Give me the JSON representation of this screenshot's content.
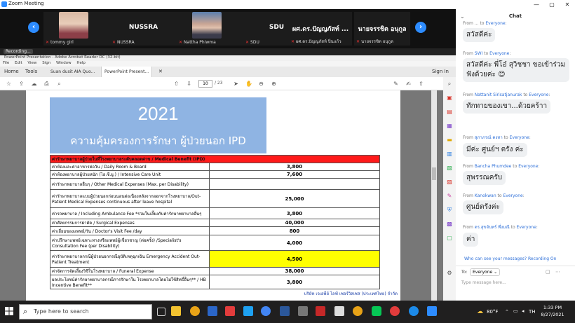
{
  "window": {
    "title": "Zoom Meeting",
    "min": "—",
    "max": "▢",
    "close": "✕"
  },
  "participants": [
    {
      "name": "",
      "label": "tommy girl",
      "photo": true
    },
    {
      "name": "NUSSRA",
      "label": "NUSSRA",
      "photo": false
    },
    {
      "name": "",
      "label": "Nattha Phiwma",
      "photo": true
    },
    {
      "name": "SDU",
      "label": "SDU",
      "photo": false
    },
    {
      "name": "ผศ.ดร.ปัญญภัสท์ ...",
      "label": "ผศ.ดร.ปัญญภัสท์ ปิ่นแก้ว",
      "photo": false
    },
    {
      "name": "นายจรรชิต อนุกูล",
      "label": "นายจรรชิต อนุกูล",
      "photo": false
    }
  ],
  "recording": "Recording...",
  "acrobat": {
    "title": "PowerPoint Presentation - Adobe Acrobat Reader DC (32-bit)",
    "menu": [
      "File",
      "Edit",
      "View",
      "Sign",
      "Window",
      "Help"
    ],
    "tabs": [
      "Home",
      "Tools",
      "Suan dusit AIA Quo...",
      "PowerPoint Present..."
    ],
    "sign_in": "Sign In",
    "page_current": "10",
    "page_total": "/ 23"
  },
  "slide": {
    "year": "2021",
    "subtitle": "ความคุ้มครองการรักษา ผู้ป่วยนอก IPD",
    "header": "ค่ารักษาพยาบาลผู้ป่วยในที่โรงพยาบาลระดับคลอดค่าข / Medical Benefit (IPD)",
    "rows": [
      {
        "label": "ค่าห้องและค่าอาหารต่อวัน  /  Daily Room & Board",
        "value": "3,800",
        "highlight": false
      },
      {
        "label": "ค่าห้องพยาบาลผู้ป่วยหนัก (ไอ.ซี.ยู.)  /  Intensive Care Unit",
        "value": "7,600",
        "highlight": false
      },
      {
        "label": "ค่ารักษาพยาบาลอื่นๆ / Other Medical Expenses (Max. per Disability)",
        "value": "",
        "highlight": false
      },
      {
        "label": "ค่ารักษาพยาบาลแบบผู้ป่วยนอกก่อนนอนต่อเนื่องหลังจากออกจากโรงพยาบาล/Out-Patient Medical Expenses continuous after leave hospital",
        "value": "25,000",
        "highlight": false
      },
      {
        "label": "ค่ารถพยาบาล / Including Ambulance Fee *รวมในเลี้ยงกับค่ารักษาพยาบาลอื่นๆ",
        "value": "3,800",
        "highlight": false
      },
      {
        "label": "ค่าศัลยกรรมการผ่าตัด / Surgical Expenses",
        "value": "40,000",
        "highlight": false
      },
      {
        "label": "ค่าเยี่ยมของแพทย์/วัน  /  Doctor's Visit Fee /day",
        "value": "800",
        "highlight": false
      },
      {
        "label": "ค่าปรึกษาแพทย์เฉพาะทางหรือแพทย์ผู้เชี่ยวชาญ (ต่อครั้ง) /Specialist's Consultation Fee (per Disability)",
        "value": "4,000",
        "highlight": false
      },
      {
        "label": "ค่ารักษาพยาบาลกรณีผู้ป่วยนอกกรณีอุบัติเหตุฉุกเฉิน  Emergency Accident Out-Patient Treatment",
        "value": "4,500",
        "highlight": true
      },
      {
        "label": "ค่าจัดการจัดเลี้ยงวิชีในโรงพยาบาล / Funeral Expense",
        "value": "38,000",
        "highlight": false
      },
      {
        "label": "ผลประโยชน์ค่ารักษาพยาบาลกรณีการรักษาใน โรงพยาบาลโดยไม่ใช้สิทธิ์อื่นๆ** / HB Incentive Benefit**",
        "value": "3,800",
        "highlight": false
      }
    ],
    "footnote": "บริษัท เจเอพีย์ ไลฟ์ เซอร์วิสเซส (ประเทศไทย) จำกัด"
  },
  "chat": {
    "title": "Chat",
    "messages": [
      {
        "from": "From",
        "sender": "...",
        "to": "Everyone",
        "text": "สวัสดีค่ะ"
      },
      {
        "from": "From",
        "sender": "SWI",
        "to": "Everyone",
        "text": "สวัสดีค่ะ พี่โอ๋ สุวิชชา ขอเข้าร่วมฟังด้วยค่ะ 😊"
      },
      {
        "from": "From",
        "sender": "Nattanit Sirisatjanurak",
        "to": "Everyone",
        "text": "ทักทายของเขา...ด้วยคร้าา"
      },
      {
        "from": "From",
        "sender": "สุภาภรณ์ คงทา",
        "to": "Everyone",
        "text": "มีค่ะ ศูนย์ฯ ตรัง ค่ะ"
      },
      {
        "from": "From",
        "sender": "Bancha Phumdee",
        "to": "Everyone",
        "text": "สุพรรณครับ"
      },
      {
        "from": "From",
        "sender": "Kanokwan",
        "to": "Everyone",
        "text": "ศูนย์ตรังค่ะ"
      },
      {
        "from": "From",
        "sender": "ดร.สุขจันทร์ พึ่งมณี",
        "to": "Everyone",
        "text": "ค่า"
      }
    ],
    "who_can_see": "Who can see your messages? Recording On",
    "to_label": "To:",
    "to_value": "Everyone",
    "placeholder": "Type message here..."
  },
  "taskbar": {
    "search": "Type here to search",
    "temperature": "80°F",
    "lang": "TH",
    "time": "1:33 PM",
    "date": "8/27/2021"
  }
}
